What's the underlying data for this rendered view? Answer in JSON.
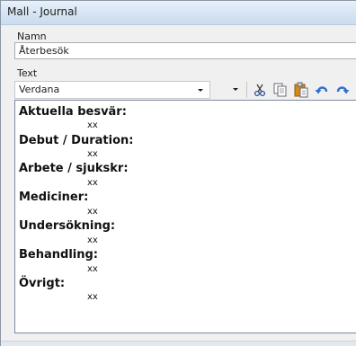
{
  "window": {
    "title": "Mall - Journal"
  },
  "form": {
    "name_label": "Namn",
    "name_value": "Återbesök",
    "text_label": "Text"
  },
  "toolbar": {
    "font_value": "Verdana",
    "size_value": "",
    "icons": [
      "cut-icon",
      "copy-icon",
      "paste-icon",
      "undo-icon",
      "redo-icon"
    ]
  },
  "editor": {
    "sections": [
      {
        "heading": "Aktuella besvär:",
        "value": "xx"
      },
      {
        "heading": "Debut / Duration:",
        "value": "xx"
      },
      {
        "heading": "Arbete / sjukskr:",
        "value": "xx"
      },
      {
        "heading": "Mediciner:",
        "value": "xx"
      },
      {
        "heading": "Undersökning:",
        "value": "xx"
      },
      {
        "heading": "Behandling:",
        "value": "xx"
      },
      {
        "heading": "Övrigt:",
        "value": "xx"
      }
    ]
  },
  "colors": {
    "titlebar_start": "#e9f1fa",
    "titlebar_end": "#cbdcef",
    "window_bg": "#f0f0f0",
    "paste_icon": "#d7881a",
    "undo_redo_icon": "#2f6fd0"
  }
}
